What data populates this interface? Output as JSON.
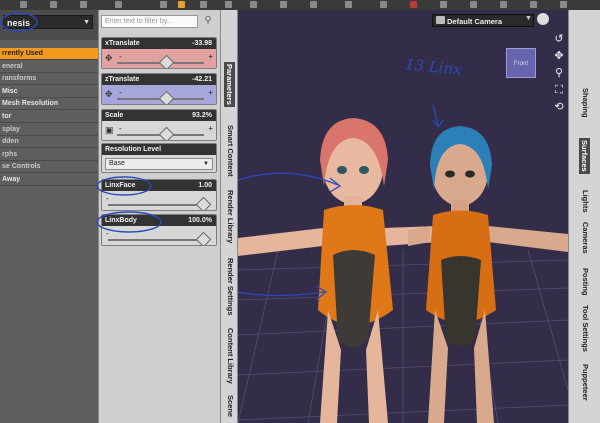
{
  "left_panel": {
    "scene_selector": "nesis",
    "menu_items": [
      {
        "label": "rrently Used",
        "state": "active"
      },
      {
        "label": "eneral",
        "state": "dim"
      },
      {
        "label": "ransforms",
        "state": "dim"
      },
      {
        "label": "Misc",
        "state": "normal"
      },
      {
        "label": "Mesh Resolution",
        "state": "normal"
      },
      {
        "label": "tor",
        "state": "normal"
      },
      {
        "label": "splay",
        "state": "dim"
      },
      {
        "label": "dden",
        "state": "dim"
      },
      {
        "label": "rphs",
        "state": "dim"
      },
      {
        "label": "se Controls",
        "state": "dim"
      },
      {
        "label": "Away",
        "state": "normal"
      }
    ]
  },
  "parameters": {
    "filter_placeholder": "Enter text to filter by...",
    "items": [
      {
        "label": "xTranslate",
        "value": "-33.98",
        "tone": "red",
        "fill": 0.58
      },
      {
        "label": "zTranslate",
        "value": "-42.21",
        "tone": "blue",
        "fill": 0.58
      },
      {
        "label": "Scale",
        "value": "93.2%",
        "tone": "gray",
        "fill": 0.58
      },
      {
        "label": "LinxFace",
        "value": "1.00",
        "tone": "gray",
        "fill": 1.0
      },
      {
        "label": "LinxBody",
        "value": "100.0%",
        "tone": "gray",
        "fill": 1.0
      }
    ],
    "resolution": {
      "label": "Resolution Level",
      "selected": "Base"
    }
  },
  "left_tabs": [
    "Parameters",
    "Smart Content",
    "Render Library",
    "Render Settings",
    "Content Library",
    "Scene"
  ],
  "right_tabs": [
    "Shaping",
    "Surfaces",
    "Lights",
    "Cameras",
    "Posting",
    "Tool Settings",
    "Puppeteer"
  ],
  "viewport": {
    "camera": "Default Camera",
    "view_cube_label": "Front",
    "annotation": "13 Linx",
    "background": "#332d4a"
  },
  "colors": {
    "accent": "#f39a1f",
    "annotation_ink": "#2b4ab8"
  }
}
